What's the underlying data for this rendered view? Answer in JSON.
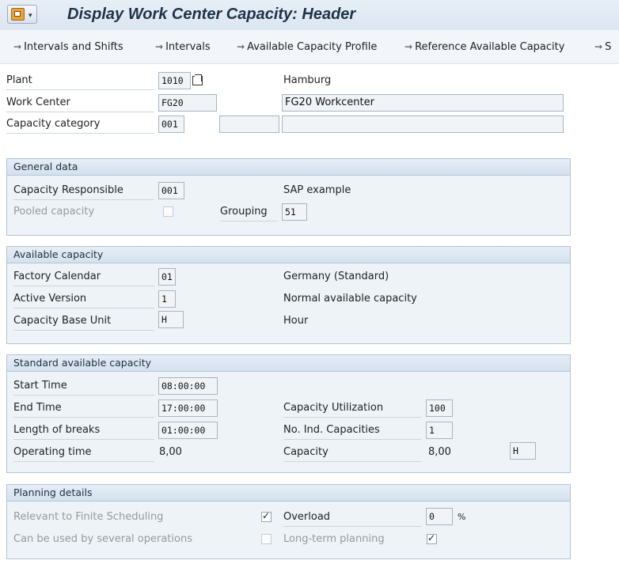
{
  "header": {
    "title": "Display Work Center Capacity: Header",
    "menu_icon": "sap-menu-icon"
  },
  "toolbar": {
    "items": [
      {
        "label": "Intervals and Shifts",
        "icon": "goto-icon"
      },
      {
        "label": "Intervals",
        "icon": "goto-icon"
      },
      {
        "label": "Available Capacity Profile",
        "icon": "goto-icon"
      },
      {
        "label": "Reference Available Capacity",
        "icon": "goto-icon"
      },
      {
        "label": "S",
        "icon": "goto-icon"
      }
    ]
  },
  "top": {
    "plant_label": "Plant",
    "plant_value": "1010",
    "plant_text": "Hamburg",
    "work_center_label": "Work Center",
    "work_center_value": "FG20",
    "work_center_text": "FG20 Workcenter",
    "capacity_category_label": "Capacity category",
    "capacity_category_value": "001",
    "capacity_category_field2": "",
    "capacity_category_field3": ""
  },
  "general": {
    "title": "General data",
    "responsible_label": "Capacity Responsible",
    "responsible_value": "001",
    "responsible_text": "SAP example",
    "pooled_label": "Pooled capacity",
    "pooled_checked": false,
    "grouping_label": "Grouping",
    "grouping_value": "51"
  },
  "available": {
    "title": "Available capacity",
    "calendar_label": "Factory Calendar",
    "calendar_value": "01",
    "calendar_text": "Germany (Standard)",
    "version_label": "Active Version",
    "version_value": "1",
    "version_text": "Normal available capacity",
    "unit_label": "Capacity Base Unit",
    "unit_value": "H",
    "unit_text": "Hour"
  },
  "standard": {
    "title": "Standard available capacity",
    "start_label": "Start Time",
    "start_value": "08:00:00",
    "end_label": "End Time",
    "end_value": "17:00:00",
    "breaks_label": "Length of breaks",
    "breaks_value": "01:00:00",
    "operating_label": "Operating time",
    "operating_value": "8,00",
    "utilization_label": "Capacity Utilization",
    "utilization_value": "100",
    "ind_capacities_label": "No. Ind. Capacities",
    "ind_capacities_value": "1",
    "capacity_label": "Capacity",
    "capacity_value": "8,00",
    "capacity_unit": "H"
  },
  "planning": {
    "title": "Planning details",
    "finite_label": "Relevant to Finite Scheduling",
    "finite_checked": true,
    "several_label": "Can be used by several operations",
    "several_checked": false,
    "overload_label": "Overload",
    "overload_value": "0",
    "overload_unit": "%",
    "longterm_label": "Long-term planning",
    "longterm_checked": true
  }
}
